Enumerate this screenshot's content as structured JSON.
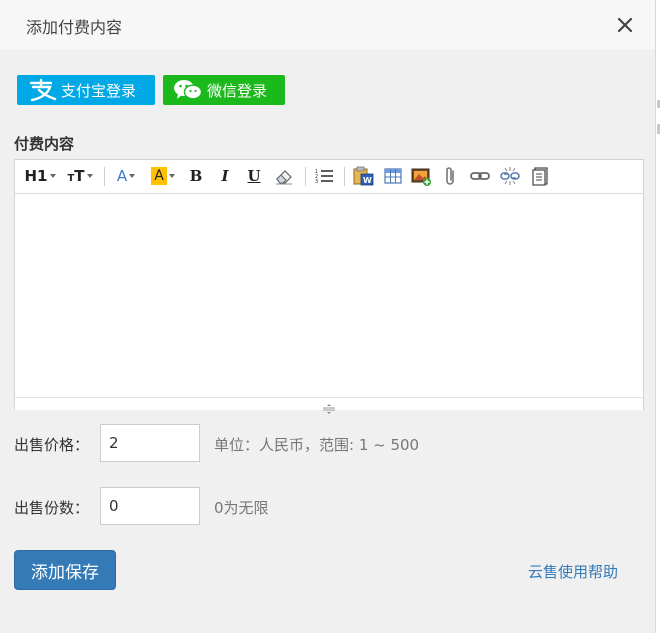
{
  "dialog": {
    "title": "添加付费内容"
  },
  "login": {
    "alipay_label": "支付宝登录",
    "wechat_label": "微信登录",
    "alipay_color": "#00a9e6",
    "wechat_color": "#1cb91c"
  },
  "content_section": {
    "label": "付费内容"
  },
  "toolbar": {
    "heading_label": "H1",
    "fontsize_label": "T",
    "fontsize_small_label": "T",
    "fontcolor_label": "A",
    "bgcolor_label": "A",
    "bold_label": "B",
    "italic_label": "I",
    "underline_label": "U",
    "icons": [
      "heading-icon",
      "font-size-icon",
      "font-color-icon",
      "background-color-icon",
      "bold-icon",
      "italic-icon",
      "underline-icon",
      "eraser-icon",
      "ordered-list-icon",
      "paste-word-icon",
      "table-icon",
      "image-icon",
      "attachment-icon",
      "link-icon",
      "unlink-icon",
      "source-icon"
    ]
  },
  "price": {
    "label": "出售价格：",
    "value": "2",
    "hint": "单位：人民币，范围: 1 ~ 500"
  },
  "quantity": {
    "label": "出售份数：",
    "value": "0",
    "hint": "0为无限"
  },
  "actions": {
    "save_label": "添加保存",
    "help_label": "云售使用帮助",
    "primary_color": "#337ab7"
  }
}
